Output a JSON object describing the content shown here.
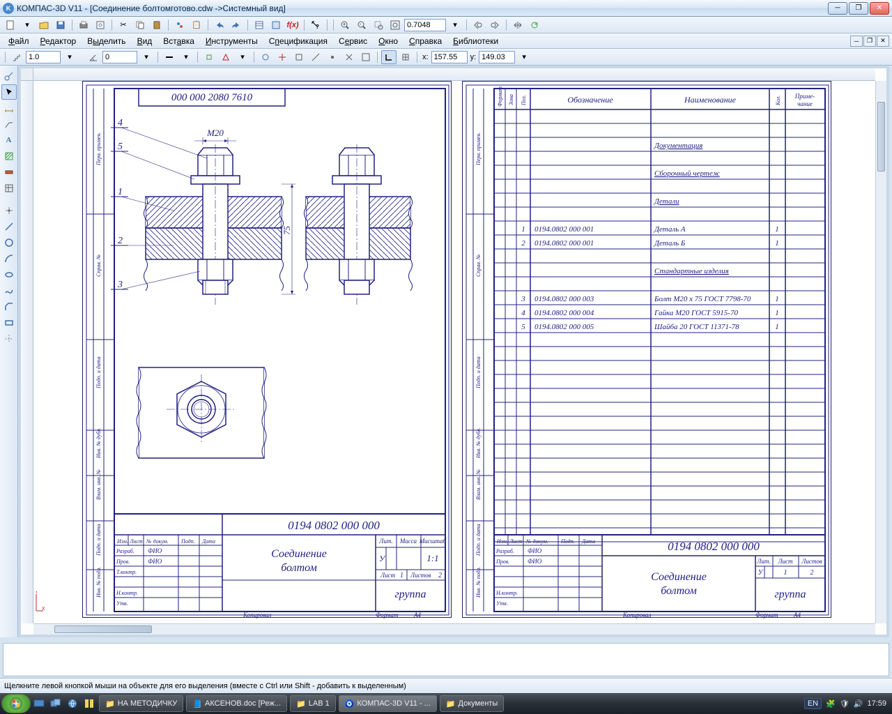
{
  "titlebar": {
    "app_icon_letter": "K",
    "title": "КОМПАС-3D V11 - [Соединение болтомготово.cdw ->Системный вид]"
  },
  "menubar": {
    "items": [
      "Файл",
      "Редактор",
      "Выделить",
      "Вид",
      "Вставка",
      "Инструменты",
      "Спецификация",
      "Сервис",
      "Окно",
      "Справка",
      "Библиотеки"
    ]
  },
  "toolbar2": {
    "zoom_value": "0.7048"
  },
  "toolbar3": {
    "step_value": "1.0",
    "angle_value": "0",
    "coord_x_label": "x:",
    "coord_x": "157.55",
    "coord_y_label": "y:",
    "coord_y": "149.03"
  },
  "drawing_left": {
    "top_code": "000 000 2080 7610",
    "dim_m20": "M20",
    "dim_75": "75",
    "callout_4": "4",
    "callout_5": "5",
    "callout_1": "1",
    "callout_2": "2",
    "callout_3": "3",
    "tb_code": "0194 0802 000 000",
    "tb_name1": "Соединение",
    "tb_name2": "болтом",
    "tb_lit": "Лит.",
    "tb_massa": "Масса",
    "tb_masshtab": "Масштаб",
    "tb_scale": "1:1",
    "tb_u": "У",
    "tb_list": "Лист",
    "tb_list_n": "1",
    "tb_listov": "Листов",
    "tb_listov_n": "2",
    "tb_gruppa": "группа",
    "tb_izm": "Изм.",
    "tb_list2": "Лист",
    "tb_ndokum": "№ докум.",
    "tb_podp": "Подп.",
    "tb_data": "Дата",
    "tb_razrab": "Разраб.",
    "tb_prov": "Пров.",
    "tb_tkontr": "Т.контр.",
    "tb_nkontr": "Н.контр.",
    "tb_utv": "Утв.",
    "tb_fio": "ФИО",
    "tb_kopiroval": "Копировал",
    "tb_format": "Формат",
    "tb_format_v": "А4",
    "side_perv": "Перв. примен.",
    "side_sprav": "Справ. №",
    "side_podp_data": "Подп. и дата",
    "side_inv": "Инв. № дубл.",
    "side_vzam": "Взам. инв. №",
    "side_inv_podl": "Инв. № подл."
  },
  "drawing_right": {
    "header_format": "Формат",
    "header_zona": "Зона",
    "header_poz": "Поз.",
    "header_oboz": "Обозначение",
    "header_naim": "Наименование",
    "header_kol": "Кол.",
    "header_prim": "Приме-чание",
    "rows": [
      {
        "poz": "",
        "oboz": "",
        "naim": "Документация",
        "kol": ""
      },
      {
        "poz": "",
        "oboz": "",
        "naim": "Сборочный чертеж",
        "kol": ""
      },
      {
        "poz": "",
        "oboz": "",
        "naim": "Детали",
        "kol": ""
      },
      {
        "poz": "1",
        "oboz": "0194.0802 000 001",
        "naim": "Деталь А",
        "kol": "1"
      },
      {
        "poz": "2",
        "oboz": "0194.0802 000 001",
        "naim": "Деталь Б",
        "kol": "1"
      },
      {
        "poz": "",
        "oboz": "",
        "naim": "Стандартные изделия",
        "kol": ""
      },
      {
        "poz": "3",
        "oboz": "0194.0802 000 003",
        "naim": "Болт М20 х 75 ГОСТ 7798-70",
        "kol": "1"
      },
      {
        "poz": "4",
        "oboz": "0194.0802 000 004",
        "naim": "Гайка М20 ГОСТ 5915-70",
        "kol": "1"
      },
      {
        "poz": "5",
        "oboz": "0194.0802 000 005",
        "naim": "Шайба 20 ГОСТ 11371-78",
        "kol": "1"
      }
    ],
    "tb_code": "0194 0802 000 000",
    "tb_name1": "Соединение",
    "tb_name2": "болтом",
    "tb_gruppa": "группа",
    "tb_lit": "Лит.",
    "tb_u": "У",
    "tb_list": "Лист",
    "tb_list_n": "1",
    "tb_listov": "Листов",
    "tb_listov_n": "2",
    "tb_kopiroval": "Копировал",
    "tb_format": "Формат",
    "tb_format_v": "А4"
  },
  "statusbar": {
    "hint": "Щелкните левой кнопкой мыши на объекте для его выделения (вместе с Ctrl или Shift - добавить к выделенным)"
  },
  "taskbar": {
    "items": [
      {
        "label": "НА МЕТОДИЧКУ",
        "icon": "folder"
      },
      {
        "label": "АКСЕНОВ.doc [Реж...",
        "icon": "word"
      },
      {
        "label": "LAB 1",
        "icon": "folder"
      },
      {
        "label": "КОМПАС-3D V11 - ...",
        "icon": "kompas",
        "active": true
      },
      {
        "label": "Документы",
        "icon": "folder"
      }
    ],
    "lang": "EN",
    "clock": "17:59"
  },
  "axis": {
    "x": "X",
    "y": "Y"
  }
}
